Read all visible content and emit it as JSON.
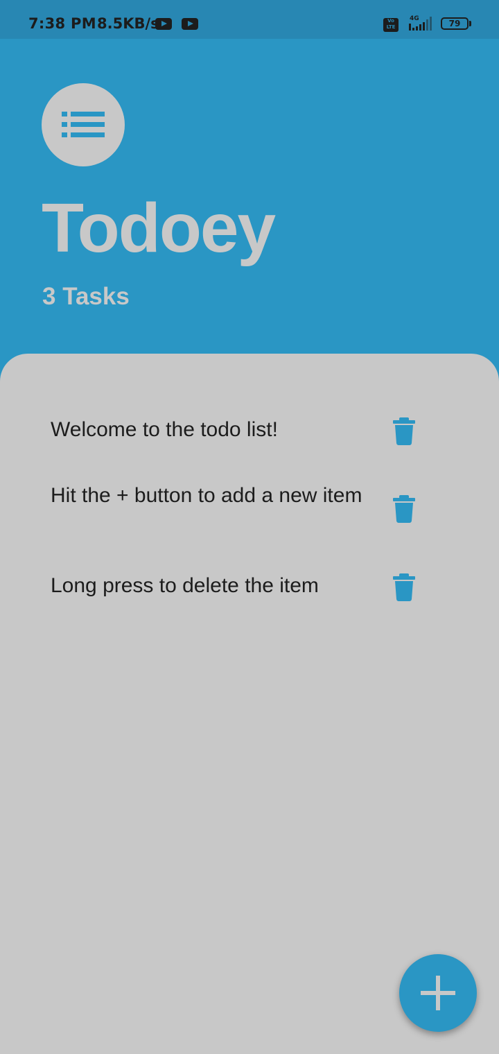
{
  "status_bar": {
    "time": "7:38 PM",
    "network_speed": "8.5KB/s",
    "network_type": "4G",
    "volte_label": "Vo LTE",
    "battery": "79"
  },
  "header": {
    "title": "Todoey",
    "task_count": "3 Tasks"
  },
  "tasks": [
    {
      "text": "Welcome to the todo list!"
    },
    {
      "text": "Hit the + button to add a new item"
    },
    {
      "text": "Long press to delete the item"
    }
  ],
  "icons": {
    "app_icon": "list-icon",
    "delete_icon": "trash-icon",
    "add_icon": "plus-icon"
  },
  "colors": {
    "accent": "#2a96c4",
    "panel": "#c8c8c8",
    "text": "#1c1c1c"
  }
}
